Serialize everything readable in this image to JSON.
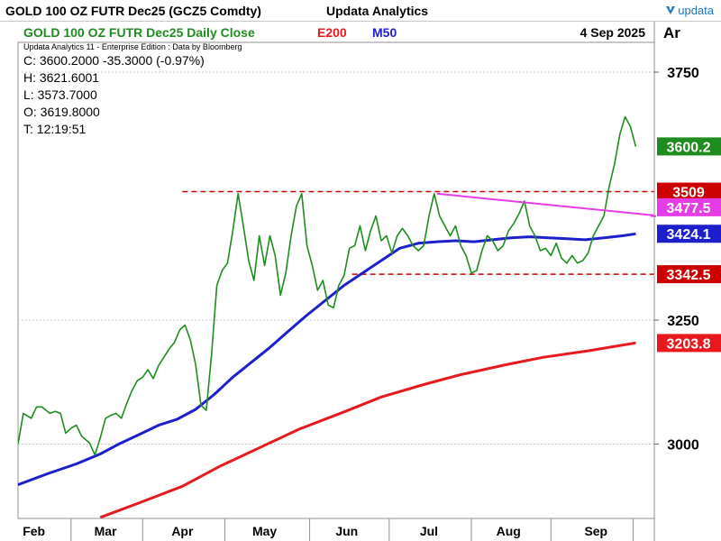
{
  "header": {
    "title": "GOLD 100 OZ FUTR  Dec25 (GCZ5 Comdty)",
    "vendor": "Updata Analytics",
    "brand": "updata"
  },
  "legend": {
    "series_title": "GOLD 100 OZ FUTR  Dec25 Daily Close",
    "e200": "E200",
    "m50": "M50",
    "date": "4 Sep 2025",
    "subtitle": "Updata Analytics 11 - Enterprise Edition : Data by Bloomberg"
  },
  "ohlc": {
    "close": "C: 3600.2000  -35.3000 (-0.97%)",
    "high": "H: 3621.6001",
    "low": "L: 3573.7000",
    "open": "O: 3619.8000",
    "time": "T: 12:19:51"
  },
  "axis_header": "Ar",
  "colors": {
    "price": "#1f8c1f",
    "e200": "#e8191c",
    "m50": "#1c20cc",
    "trend": "#e53de5",
    "level": "#cc0000",
    "grid": "#c8c8c8"
  },
  "chart_data": {
    "type": "line",
    "title": "GOLD 100 OZ FUTR  Dec25 Daily Close",
    "x_axis": {
      "type": "date",
      "tick_labels": [
        "Feb",
        "Mar",
        "Apr",
        "May",
        "Jun",
        "Jul",
        "Aug",
        "Sep"
      ],
      "range": [
        "2025-01-29",
        "2025-09-26"
      ]
    },
    "y_axis": {
      "position": "right",
      "range": [
        2850,
        3810
      ],
      "ticks": [
        3000,
        3250,
        3750
      ],
      "grid": true
    },
    "series": [
      {
        "name": "GOLD 100 OZ FUTR  Dec25 Daily Close",
        "color": "#1f8c1f",
        "points": [
          [
            "2025-01-29",
            3000
          ],
          [
            "2025-01-31",
            3062
          ],
          [
            "2025-02-03",
            3052
          ],
          [
            "2025-02-05",
            3075
          ],
          [
            "2025-02-07",
            3075
          ],
          [
            "2025-02-10",
            3062
          ],
          [
            "2025-02-12",
            3066
          ],
          [
            "2025-02-14",
            3062
          ],
          [
            "2025-02-16",
            3022
          ],
          [
            "2025-02-18",
            3032
          ],
          [
            "2025-02-20",
            3038
          ],
          [
            "2025-02-22",
            3016
          ],
          [
            "2025-02-25",
            3002
          ],
          [
            "2025-02-27",
            2978
          ],
          [
            "2025-03-01",
            3012
          ],
          [
            "2025-03-03",
            3052
          ],
          [
            "2025-03-05",
            3058
          ],
          [
            "2025-03-07",
            3062
          ],
          [
            "2025-03-09",
            3052
          ],
          [
            "2025-03-11",
            3082
          ],
          [
            "2025-03-13",
            3108
          ],
          [
            "2025-03-15",
            3128
          ],
          [
            "2025-03-17",
            3135
          ],
          [
            "2025-03-19",
            3150
          ],
          [
            "2025-03-21",
            3132
          ],
          [
            "2025-03-23",
            3158
          ],
          [
            "2025-03-25",
            3175
          ],
          [
            "2025-03-27",
            3192
          ],
          [
            "2025-03-29",
            3205
          ],
          [
            "2025-03-31",
            3230
          ],
          [
            "2025-04-02",
            3240
          ],
          [
            "2025-04-04",
            3210
          ],
          [
            "2025-04-06",
            3160
          ],
          [
            "2025-04-08",
            3078
          ],
          [
            "2025-04-10",
            3068
          ],
          [
            "2025-04-12",
            3180
          ],
          [
            "2025-04-14",
            3320
          ],
          [
            "2025-04-16",
            3350
          ],
          [
            "2025-04-18",
            3365
          ],
          [
            "2025-04-20",
            3430
          ],
          [
            "2025-04-22",
            3505
          ],
          [
            "2025-04-24",
            3440
          ],
          [
            "2025-04-26",
            3370
          ],
          [
            "2025-04-28",
            3330
          ],
          [
            "2025-04-30",
            3420
          ],
          [
            "2025-05-02",
            3360
          ],
          [
            "2025-05-04",
            3420
          ],
          [
            "2025-05-06",
            3380
          ],
          [
            "2025-05-08",
            3300
          ],
          [
            "2025-05-10",
            3345
          ],
          [
            "2025-05-12",
            3420
          ],
          [
            "2025-05-14",
            3480
          ],
          [
            "2025-05-16",
            3505
          ],
          [
            "2025-05-18",
            3400
          ],
          [
            "2025-05-20",
            3360
          ],
          [
            "2025-05-22",
            3310
          ],
          [
            "2025-05-24",
            3330
          ],
          [
            "2025-05-26",
            3280
          ],
          [
            "2025-05-28",
            3275
          ],
          [
            "2025-05-30",
            3320
          ],
          [
            "2025-06-01",
            3340
          ],
          [
            "2025-06-03",
            3395
          ],
          [
            "2025-06-05",
            3400
          ],
          [
            "2025-06-07",
            3440
          ],
          [
            "2025-06-09",
            3390
          ],
          [
            "2025-06-11",
            3430
          ],
          [
            "2025-06-13",
            3460
          ],
          [
            "2025-06-15",
            3410
          ],
          [
            "2025-06-17",
            3420
          ],
          [
            "2025-06-19",
            3385
          ],
          [
            "2025-06-21",
            3420
          ],
          [
            "2025-06-23",
            3435
          ],
          [
            "2025-06-25",
            3420
          ],
          [
            "2025-06-27",
            3400
          ],
          [
            "2025-06-29",
            3390
          ],
          [
            "2025-07-01",
            3400
          ],
          [
            "2025-07-03",
            3460
          ],
          [
            "2025-07-05",
            3505
          ],
          [
            "2025-07-07",
            3460
          ],
          [
            "2025-07-09",
            3440
          ],
          [
            "2025-07-11",
            3420
          ],
          [
            "2025-07-13",
            3440
          ],
          [
            "2025-07-15",
            3400
          ],
          [
            "2025-07-17",
            3380
          ],
          [
            "2025-07-19",
            3345
          ],
          [
            "2025-07-21",
            3350
          ],
          [
            "2025-07-23",
            3390
          ],
          [
            "2025-07-25",
            3420
          ],
          [
            "2025-07-27",
            3410
          ],
          [
            "2025-07-29",
            3390
          ],
          [
            "2025-07-31",
            3400
          ],
          [
            "2025-08-02",
            3430
          ],
          [
            "2025-08-04",
            3445
          ],
          [
            "2025-08-06",
            3465
          ],
          [
            "2025-08-08",
            3490
          ],
          [
            "2025-08-10",
            3440
          ],
          [
            "2025-08-12",
            3420
          ],
          [
            "2025-08-14",
            3390
          ],
          [
            "2025-08-16",
            3395
          ],
          [
            "2025-08-18",
            3380
          ],
          [
            "2025-08-20",
            3405
          ],
          [
            "2025-08-22",
            3375
          ],
          [
            "2025-08-24",
            3365
          ],
          [
            "2025-08-26",
            3380
          ],
          [
            "2025-08-28",
            3365
          ],
          [
            "2025-08-30",
            3370
          ],
          [
            "2025-09-01",
            3385
          ],
          [
            "2025-09-03",
            3420
          ],
          [
            "2025-09-05",
            3440
          ],
          [
            "2025-09-07",
            3460
          ],
          [
            "2025-09-09",
            3520
          ],
          [
            "2025-09-11",
            3565
          ],
          [
            "2025-09-13",
            3625
          ],
          [
            "2025-09-15",
            3660
          ],
          [
            "2025-09-17",
            3640
          ],
          [
            "2025-09-19",
            3600
          ]
        ]
      },
      {
        "name": "M50",
        "color": "#1c20cc",
        "points": [
          [
            "2025-01-29",
            2918
          ],
          [
            "2025-02-09",
            2940
          ],
          [
            "2025-02-20",
            2960
          ],
          [
            "2025-03-01",
            2980
          ],
          [
            "2025-03-08",
            3000
          ],
          [
            "2025-03-16",
            3020
          ],
          [
            "2025-03-23",
            3038
          ],
          [
            "2025-03-30",
            3050
          ],
          [
            "2025-04-06",
            3070
          ],
          [
            "2025-04-13",
            3100
          ],
          [
            "2025-04-20",
            3135
          ],
          [
            "2025-04-27",
            3165
          ],
          [
            "2025-05-04",
            3195
          ],
          [
            "2025-05-11",
            3228
          ],
          [
            "2025-05-18",
            3260
          ],
          [
            "2025-05-25",
            3290
          ],
          [
            "2025-06-01",
            3320
          ],
          [
            "2025-06-08",
            3345
          ],
          [
            "2025-06-15",
            3370
          ],
          [
            "2025-06-22",
            3395
          ],
          [
            "2025-06-29",
            3405
          ],
          [
            "2025-07-06",
            3408
          ],
          [
            "2025-07-13",
            3410
          ],
          [
            "2025-07-20",
            3408
          ],
          [
            "2025-07-27",
            3412
          ],
          [
            "2025-08-03",
            3416
          ],
          [
            "2025-08-10",
            3418
          ],
          [
            "2025-08-17",
            3416
          ],
          [
            "2025-08-24",
            3414
          ],
          [
            "2025-08-31",
            3412
          ],
          [
            "2025-09-07",
            3416
          ],
          [
            "2025-09-14",
            3420
          ],
          [
            "2025-09-19",
            3424
          ]
        ]
      },
      {
        "name": "E200",
        "color": "#e8191c",
        "points": [
          [
            "2025-03-01",
            2852
          ],
          [
            "2025-03-15",
            2880
          ],
          [
            "2025-04-01",
            2915
          ],
          [
            "2025-04-15",
            2955
          ],
          [
            "2025-05-01",
            2995
          ],
          [
            "2025-05-15",
            3030
          ],
          [
            "2025-06-01",
            3065
          ],
          [
            "2025-06-15",
            3095
          ],
          [
            "2025-07-01",
            3120
          ],
          [
            "2025-07-15",
            3140
          ],
          [
            "2025-08-01",
            3160
          ],
          [
            "2025-08-15",
            3175
          ],
          [
            "2025-09-01",
            3188
          ],
          [
            "2025-09-19",
            3204
          ]
        ]
      }
    ],
    "trendline": {
      "color": "#e53de5",
      "points": [
        [
          "2025-07-06",
          3505
        ],
        [
          "2025-09-28",
          3460
        ]
      ]
    },
    "levels": [
      {
        "value": 3509,
        "from": "2025-04-01",
        "to": "2025-09-28"
      },
      {
        "value": 3342.5,
        "from": "2025-06-04",
        "to": "2025-09-28"
      }
    ],
    "value_labels": [
      {
        "text": "3600.2",
        "value": 3600.2,
        "bg": "#1f8c1f",
        "fg": "#ffffff"
      },
      {
        "text": "3509",
        "value": 3509,
        "bg": "#cc0000",
        "fg": "#ffffff"
      },
      {
        "text": "3477.5",
        "value": 3477.5,
        "bg": "#e53de5",
        "fg": "#ffffff"
      },
      {
        "text": "3424.1",
        "value": 3424.1,
        "bg": "#1c20cc",
        "fg": "#ffffff"
      },
      {
        "text": "3342.5",
        "value": 3342.5,
        "bg": "#cc0000",
        "fg": "#ffffff"
      },
      {
        "text": "3203.8",
        "value": 3203.8,
        "bg": "#e8191c",
        "fg": "#ffffff"
      }
    ]
  }
}
